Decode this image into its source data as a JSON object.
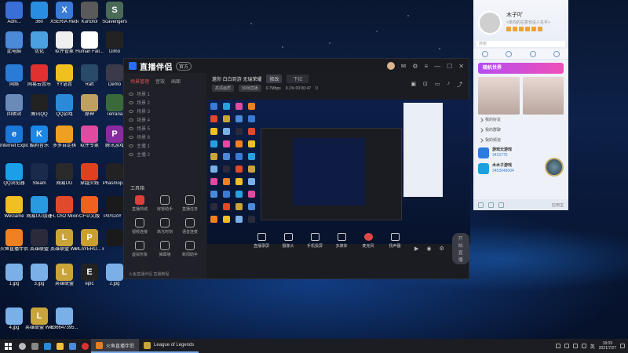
{
  "desktop": {
    "icons": [
      {
        "label": "Adm...",
        "color": "#3a6fd8",
        "glyph": ""
      },
      {
        "label": "360",
        "color": "#2a8ee0",
        "glyph": ""
      },
      {
        "label": "XSERIA Rede...",
        "color": "#3a7bd5",
        "glyph": "X"
      },
      {
        "label": "Kurtofol",
        "color": "#5a5a5a",
        "glyph": ""
      },
      {
        "label": "Scavengers",
        "color": "#4a6a58",
        "glyph": "S"
      },
      {
        "label": "此电脑",
        "color": "#4a8ad8",
        "glyph": ""
      },
      {
        "label": "优化",
        "color": "#4aa0e0",
        "glyph": ""
      },
      {
        "label": "软件管家",
        "color": "#f0f0f0",
        "glyph": ""
      },
      {
        "label": "Human Fall...",
        "color": "#ffffff",
        "glyph": ""
      },
      {
        "label": "Dimo",
        "color": "#222222",
        "glyph": ""
      },
      {
        "label": "网络",
        "color": "#2a7ad8",
        "glyph": ""
      },
      {
        "label": "网易云音乐",
        "color": "#e03030",
        "glyph": ""
      },
      {
        "label": "YY语音",
        "color": "#f0c020",
        "glyph": ""
      },
      {
        "label": "Raft",
        "color": "#2a4a6a",
        "glyph": ""
      },
      {
        "label": "Demo",
        "color": "#3a3a4a",
        "glyph": ""
      },
      {
        "label": "回收站",
        "color": "#6a8ab8",
        "glyph": ""
      },
      {
        "label": "腾讯QQ",
        "color": "#222222",
        "glyph": ""
      },
      {
        "label": "QQ游戏",
        "color": "#2a8ad8",
        "glyph": ""
      },
      {
        "label": "原神",
        "color": "#c0a060",
        "glyph": ""
      },
      {
        "label": "Terraria",
        "color": "#3a6a3a",
        "glyph": ""
      },
      {
        "label": "Internet Explorer",
        "color": "#1a78d8",
        "glyph": "e"
      },
      {
        "label": "酷狗音乐",
        "color": "#1a88e8",
        "glyph": "K"
      },
      {
        "label": "多多自走棋",
        "color": "#f0a020",
        "glyph": ""
      },
      {
        "label": "软件专家",
        "color": "#e04aa0",
        "glyph": ""
      },
      {
        "label": "腾讯游戏",
        "color": "#8a2aa0",
        "glyph": "P"
      },
      {
        "label": "QQ浏览器",
        "color": "#1aa0e8",
        "glyph": ""
      },
      {
        "label": "Steam",
        "color": "#1a2a4a",
        "glyph": ""
      },
      {
        "label": "网易UU",
        "color": "#2a2a2a",
        "glyph": ""
      },
      {
        "label": "穿越火线",
        "color": "#e04020",
        "glyph": ""
      },
      {
        "label": "Phasmop...",
        "color": "#222222",
        "glyph": ""
      },
      {
        "label": "WeGame",
        "color": "#f0c020",
        "glyph": ""
      },
      {
        "label": "网易UU加速",
        "color": "#2a9ae0",
        "glyph": ""
      },
      {
        "label": "FL OS2 Mixinc...",
        "color": "#e04a2a",
        "glyph": ""
      },
      {
        "label": "CF中文版",
        "color": "#f06020",
        "glyph": ""
      },
      {
        "label": "PAYDAY 2",
        "color": "#1a1a1a",
        "glyph": ""
      },
      {
        "label": "火鱼直播伴侣",
        "color": "#f08020",
        "glyph": ""
      },
      {
        "label": "英雄联盟",
        "color": "#2a2a3a",
        "glyph": ""
      },
      {
        "label": "英雄联盟 WeGame版",
        "color": "#c9a43b",
        "glyph": "L"
      },
      {
        "label": "PLAYERU... BATTLEGR...",
        "color": "#c9a030",
        "glyph": "P"
      },
      {
        "label": "",
        "color": "#1a1a1a",
        "glyph": ""
      },
      {
        "label": "1.jpg",
        "color": "#7ab0e8",
        "glyph": ""
      },
      {
        "label": "3.jpg",
        "color": "#7ab0e8",
        "glyph": ""
      },
      {
        "label": "英雄联盟",
        "color": "#c9a43b",
        "glyph": "L"
      },
      {
        "label": "epic",
        "color": "#222222",
        "glyph": "E"
      },
      {
        "label": "2.jpg",
        "color": "#7ab0e8",
        "glyph": ""
      },
      {
        "label": "4.jpg",
        "color": "#7ab0e8",
        "glyph": ""
      },
      {
        "label": "英雄联盟 WeGame版",
        "color": "#c9a43b",
        "glyph": "L"
      },
      {
        "label": "636647395...",
        "color": "#7ab0e8",
        "glyph": ""
      }
    ]
  },
  "app": {
    "name": "直播伴侣",
    "version": "官方",
    "left_tabs": [
      "场景管理",
      "音效",
      "画面"
    ],
    "scenes": [
      "场景 1",
      "场景 2",
      "场景 3",
      "场景 4",
      "场景 5",
      "场景 6",
      "主播 1",
      "主播 2"
    ],
    "tools_title": "工具箱",
    "tools": [
      {
        "label": "直播商城",
        "highlight": true
      },
      {
        "label": "房管助手",
        "highlight": false
      },
      {
        "label": "直播任务",
        "highlight": false
      },
      {
        "label": "视频连接",
        "highlight": false
      },
      {
        "label": "高光时刻",
        "highlight": false
      },
      {
        "label": "语音连麦",
        "highlight": false
      },
      {
        "label": "虚拟形象",
        "highlight": false
      },
      {
        "label": "弹幕墙",
        "highlight": false
      },
      {
        "label": "新闻助手",
        "highlight": false
      }
    ],
    "footer": "火鱼直播伴侣 直播教程",
    "top_title": "邀你 白白到游 无瑞荣耀",
    "top_chip": "修改",
    "top_select": "下拉",
    "sub_pills": [
      "高清画质",
      "90帧直播"
    ],
    "sub_stats": [
      "0.7Mbps",
      "0.1% 00:00:47",
      "0"
    ],
    "bottom_buttons": [
      {
        "label": "直播录屏",
        "kind": "normal"
      },
      {
        "label": "摄像头",
        "kind": "normal"
      },
      {
        "label": "手机投屏",
        "kind": "normal"
      },
      {
        "label": "多媒体",
        "kind": "normal"
      },
      {
        "label": "麦克风",
        "kind": "mic"
      },
      {
        "label": "扬声器",
        "kind": "normal"
      }
    ],
    "start_label": "开始直播"
  },
  "qq": {
    "nickname": "木子吖",
    "signature": "<单向的在意也没人在乎>",
    "search_placeholder": "搜索",
    "banner": "随机世界",
    "rows": [
      "我的好友",
      "我的群聊",
      "我的频道"
    ],
    "contacts": [
      {
        "name": "游戏云游戏",
        "sub": "3415770"
      },
      {
        "name": "木木子游戏",
        "sub": "3453048004"
      }
    ],
    "footer_ad": "应用宝"
  },
  "taskbar": {
    "tasks": [
      {
        "label": "火鱼直播伴侣",
        "active": true,
        "icon": "app"
      },
      {
        "label": "League of Legends",
        "active": false,
        "icon": "lol"
      }
    ],
    "time": "18:09",
    "date": "2021/7/27",
    "lang": "英"
  }
}
